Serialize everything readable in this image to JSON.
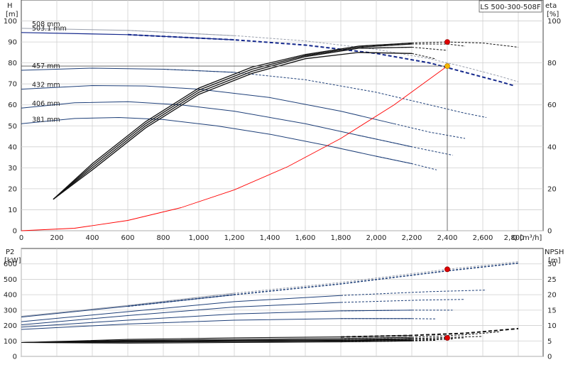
{
  "chart_data": [
    {
      "type": "line",
      "name": "head-efficiency",
      "title": "LS 500-300-508F",
      "xlabel": "Q [m³/h]",
      "ylabel": "H",
      "ylabel_unit": "[m]",
      "y2label": "eta",
      "y2label_unit": "[%]",
      "xlim": [
        0,
        2940
      ],
      "ylim": [
        0,
        110
      ],
      "y2lim": [
        0,
        110
      ],
      "xticks": [
        0,
        200,
        400,
        600,
        800,
        1000,
        1200,
        1400,
        1600,
        1800,
        2000,
        2200,
        2400,
        2600,
        2800
      ],
      "xtick_labels": [
        "0",
        "200",
        "400",
        "600",
        "800",
        "1,000",
        "1,200",
        "1,400",
        "1,600",
        "1,800",
        "2,000",
        "2,200",
        "2,400",
        "2,600",
        "2,800"
      ],
      "yticks": [
        0,
        10,
        20,
        30,
        40,
        50,
        60,
        70,
        80,
        90,
        100
      ],
      "y2ticks": [
        0,
        20,
        40,
        60,
        80,
        100
      ],
      "grid": true,
      "head_series": [
        {
          "name": "508 mm",
          "color": "#9aa0ad",
          "x": [
            0,
            600,
            1200,
            1600,
            2000,
            2300,
            2500,
            2700,
            2800
          ],
          "y": [
            96.5,
            95.5,
            93,
            90.5,
            86.5,
            82,
            78,
            73.5,
            71
          ]
        },
        {
          "name": "503.1 mm",
          "color": "#14288c",
          "x": [
            0,
            600,
            1200,
            1600,
            2000,
            2300,
            2500,
            2700,
            2780
          ],
          "y": [
            94.5,
            93.5,
            91,
            88.5,
            84.5,
            80,
            75.5,
            71,
            69
          ]
        },
        {
          "name": "457 mm",
          "color": "#1e3f78",
          "x": [
            0,
            400,
            800,
            1200,
            1600,
            2000,
            2300,
            2500,
            2620
          ],
          "y": [
            76.5,
            77.5,
            77,
            75.5,
            72,
            66,
            60,
            56,
            54
          ]
        },
        {
          "name": "432 mm",
          "color": "#1e3f78",
          "x": [
            0,
            400,
            700,
            1000,
            1400,
            1800,
            2100,
            2300,
            2500
          ],
          "y": [
            67.5,
            69.2,
            69,
            67.5,
            63.5,
            57,
            51,
            47,
            44
          ]
        },
        {
          "name": "406 mm",
          "color": "#1e3f78",
          "x": [
            0,
            300,
            600,
            900,
            1200,
            1600,
            1900,
            2200,
            2430
          ],
          "y": [
            58.5,
            61,
            61.5,
            60,
            57,
            51,
            45.5,
            40,
            36
          ]
        },
        {
          "name": "381 mm",
          "color": "#1e3f78",
          "x": [
            0,
            300,
            550,
            800,
            1100,
            1400,
            1700,
            2000,
            2200,
            2340
          ],
          "y": [
            51,
            53.5,
            54,
            53,
            50,
            46,
            41,
            35.5,
            32,
            29
          ]
        }
      ],
      "efficiency_series": [
        {
          "x": [
            180,
            400,
            700,
            1000,
            1300,
            1600,
            1900,
            2200,
            2400,
            2600,
            2800
          ],
          "y": [
            15,
            32,
            52,
            68,
            78,
            84,
            88,
            89.5,
            90,
            89.5,
            87.5
          ]
        },
        {
          "x": [
            180,
            400,
            700,
            1000,
            1300,
            1600,
            1900,
            2200,
            2400,
            2500
          ],
          "y": [
            15,
            31,
            51,
            67,
            77,
            83.5,
            87.5,
            89,
            89,
            88
          ]
        },
        {
          "x": [
            180,
            400,
            700,
            1000,
            1300,
            1600,
            1900,
            2200,
            2400
          ],
          "y": [
            15,
            30,
            50,
            66,
            76,
            83,
            87,
            87.5,
            86
          ]
        },
        {
          "x": [
            180,
            400,
            700,
            1000,
            1300,
            1600,
            1900,
            2200,
            2330
          ],
          "y": [
            15,
            29,
            49,
            65,
            75,
            82,
            85,
            84.5,
            82
          ]
        }
      ],
      "system_curve": {
        "color": "#ff0000",
        "x": [
          0,
          300,
          600,
          900,
          1200,
          1500,
          1800,
          2100,
          2400
        ],
        "y": [
          0,
          1.2,
          4.9,
          11,
          19.5,
          30.5,
          44,
          60,
          78.5
        ]
      },
      "duty_point": {
        "x": 2400,
        "y": 78.5,
        "eta": 90
      }
    },
    {
      "type": "line",
      "name": "power-npsh",
      "xlabel": "",
      "ylabel": "P2",
      "ylabel_unit": "[kW]",
      "y2label": "NPSH",
      "y2label_unit": "[m]",
      "xlim": [
        0,
        2940
      ],
      "ylim": [
        0,
        700
      ],
      "y2lim": [
        0,
        35
      ],
      "yticks": [
        0,
        100,
        200,
        300,
        400,
        500,
        600
      ],
      "y2ticks": [
        0,
        5,
        10,
        15,
        20,
        25,
        30
      ],
      "grid": true,
      "power_series": [
        {
          "name": "508 mm",
          "x": [
            0,
            600,
            1200,
            1800,
            2400,
            2800
          ],
          "y": [
            260,
            330,
            410,
            480,
            565,
            615
          ]
        },
        {
          "name": "503.1 mm",
          "x": [
            0,
            600,
            1200,
            1800,
            2400,
            2800
          ],
          "y": [
            255,
            325,
            400,
            470,
            555,
            605
          ]
        },
        {
          "name": "457 mm",
          "x": [
            0,
            600,
            1200,
            1800,
            2300,
            2620
          ],
          "y": [
            225,
            290,
            355,
            395,
            420,
            430
          ]
        },
        {
          "name": "432 mm",
          "x": [
            0,
            600,
            1200,
            1800,
            2250,
            2500
          ],
          "y": [
            205,
            265,
            320,
            350,
            365,
            370
          ]
        },
        {
          "name": "406 mm",
          "x": [
            0,
            600,
            1200,
            1800,
            2200,
            2430
          ],
          "y": [
            190,
            235,
            275,
            295,
            300,
            300
          ]
        },
        {
          "name": "381 mm",
          "x": [
            0,
            600,
            1200,
            1800,
            2200,
            2340
          ],
          "y": [
            175,
            210,
            235,
            245,
            245,
            243
          ]
        }
      ],
      "npsh_series": [
        {
          "x": [
            0,
            600,
            1200,
            1800,
            2200,
            2500,
            2800
          ],
          "y": [
            4.5,
            5.5,
            6,
            6.3,
            6.8,
            7.5,
            9
          ]
        },
        {
          "x": [
            0,
            600,
            1200,
            1800,
            2200,
            2500,
            2700
          ],
          "y": [
            4.5,
            5.2,
            5.5,
            5.8,
            6.2,
            7,
            8
          ]
        },
        {
          "x": [
            0,
            600,
            1200,
            1800,
            2200,
            2600
          ],
          "y": [
            4.5,
            5,
            5.2,
            5.4,
            5.8,
            6.5
          ]
        },
        {
          "x": [
            0,
            600,
            1200,
            1800,
            2200,
            2500
          ],
          "y": [
            4.5,
            4.8,
            5,
            5.2,
            5.5,
            6
          ]
        },
        {
          "x": [
            0,
            600,
            1200,
            1800,
            2200,
            2430
          ],
          "y": [
            4.5,
            4.6,
            4.8,
            5,
            5.2,
            5.6
          ]
        },
        {
          "x": [
            0,
            600,
            1200,
            1800,
            2200,
            2340
          ],
          "y": [
            4.5,
            4.3,
            4.5,
            4.7,
            5,
            5.2
          ]
        }
      ],
      "duty_power": {
        "x": 2400,
        "y": 565
      },
      "duty_npsh": {
        "x": 2400,
        "y": 6
      }
    }
  ]
}
